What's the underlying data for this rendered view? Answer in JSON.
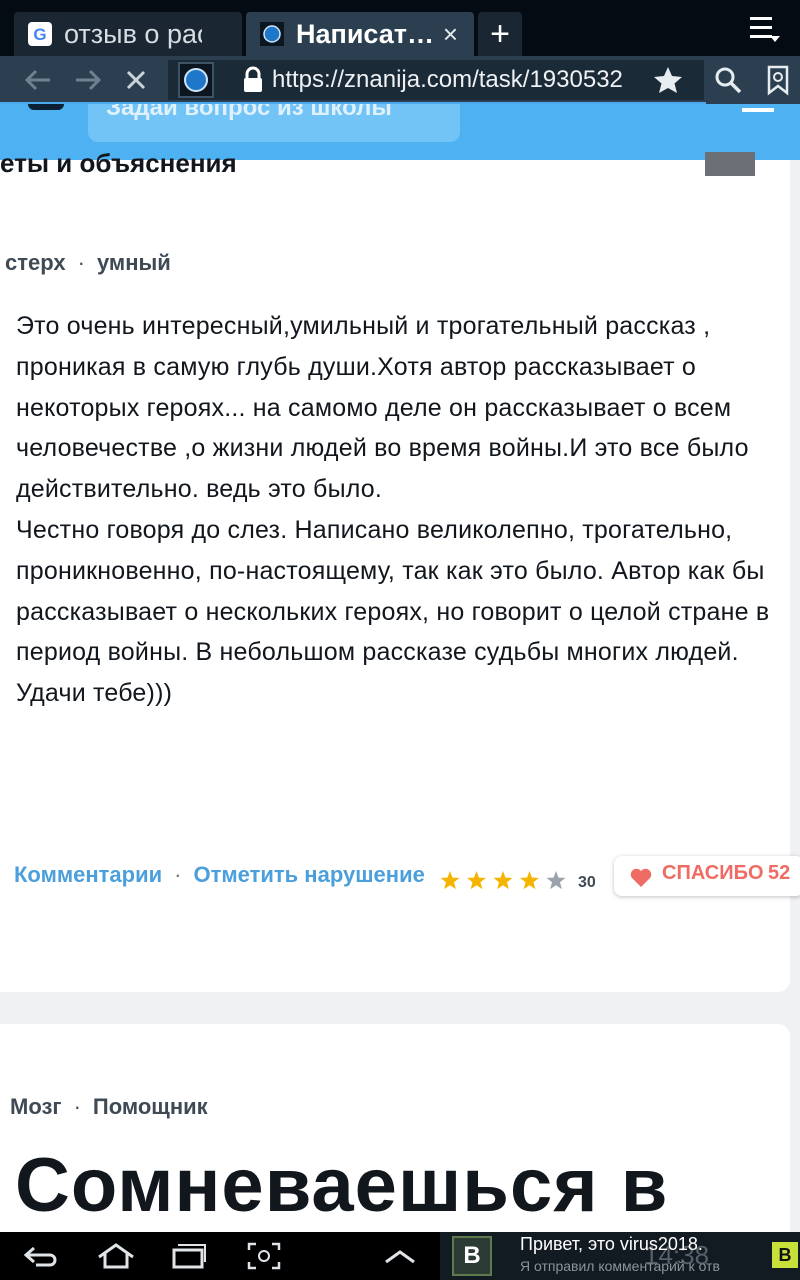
{
  "browser": {
    "tabs": [
      {
        "title": "отзыв о рас…",
        "favicon": "google-icon",
        "active": false
      },
      {
        "title": "Написат…",
        "favicon": "globe-icon",
        "active": true,
        "close": "×"
      }
    ],
    "new_tab": "+",
    "url": "https://znanija.com/task/1930532"
  },
  "site": {
    "search_placeholder": "Задай вопрос из школы",
    "section_title": "еты и объяснения"
  },
  "answer": {
    "author": "стерх",
    "rank": "умный",
    "paragraphs": [
      "Это очень интересный,умильный и трогательный рассказ , проникая в самую глубь души.Хотя автор рассказывает о некоторых героях... на самомо деле он рассказывает о всем человечестве ,о жизни людей во время войны.И это все было действительно. ведь это было.",
      "Честно говоря до слез. Написано великолепно, трогательно, проникновенно, по-настоящему, так как это было. Автор как бы рассказывает о нескольких героях, но говорит о целой стране в период войны. В небольшом рассказе судьбы многих людей.",
      "Удачи тебе)))"
    ],
    "comments_link": "Комментарии",
    "report_link": "Отметить нарушение",
    "rating": 4,
    "rating_count": "30",
    "thanks_label": "СПАСИБО",
    "thanks_count": "52"
  },
  "answer2": {
    "author": "Мозг",
    "rank": "Помощник",
    "headline": "Сомневаешься в"
  },
  "notification": {
    "app": "B",
    "title": "Привет, это virus2018.",
    "subtitle": "Я отправил комментарий к отв",
    "time": "14:38"
  },
  "colors": {
    "header_blue": "#4eb2f2",
    "link_blue": "#4b9fdc",
    "star_gold": "#f5b400",
    "thanks_red": "#ef6c64"
  }
}
